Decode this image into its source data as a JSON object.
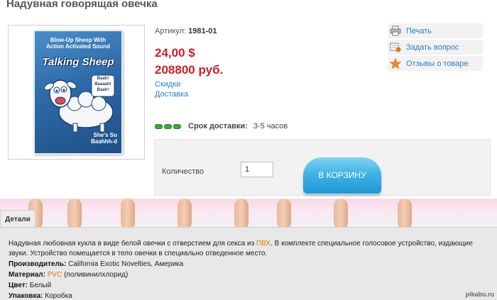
{
  "product": {
    "title": "Надувная говорящая овечка",
    "sku_label": "Артикул:",
    "sku_value": "1981-01",
    "price_usd": "24,00 $",
    "price_rub": "208800 руб.",
    "link_discounts": "Скидки",
    "link_delivery": "Доставка"
  },
  "packaging_art": {
    "tagline_1": "Blow-Up Sheep With",
    "tagline_2": "Action Activated Sound",
    "brand": "Talking Sheep",
    "speech": "Baah! Baaaah! Baah!",
    "bottom_1": "She's So",
    "bottom_2": "Baahhh-d"
  },
  "actions": [
    {
      "label": "Печать",
      "icon": "printer-icon"
    },
    {
      "label": "Задать вопрос",
      "icon": "question-icon"
    },
    {
      "label": "Отзывы о товаре",
      "icon": "star-icon"
    }
  ],
  "delivery": {
    "label": "Срок доставки:",
    "value": "3-5 часов",
    "indicator_color": "#3aa63a"
  },
  "cart": {
    "quantity_label": "Количество",
    "quantity_value": "1",
    "button_label": "В КОРЗИНУ"
  },
  "tabs": {
    "details": "Детали"
  },
  "details": {
    "desc_1": "Надувная любовная кукла в виде белой овечки с отверстием для секса из ",
    "desc_highlight": "ПВХ",
    "desc_2": ". В комплекте специальное голосовое устройство, издающие звуки. Устройство помещается в тело овечки в специально отведенное место.",
    "producer_label": "Производитель:",
    "producer_value": " California Exotic Novelties, Америка",
    "material_label": "Материал:",
    "material_highlight": "PVC",
    "material_value": " (поливинилхлорид)",
    "color_label": "Цвет:",
    "color_value": " Белый",
    "package_label": "Упаковка:",
    "package_value": " Коробка"
  },
  "watermark": "pikabu.ru",
  "colors": {
    "price": "#cc1f28",
    "link": "#2a7ec4",
    "cart_button": "#3fb2e6",
    "highlight": "#e07a12"
  }
}
